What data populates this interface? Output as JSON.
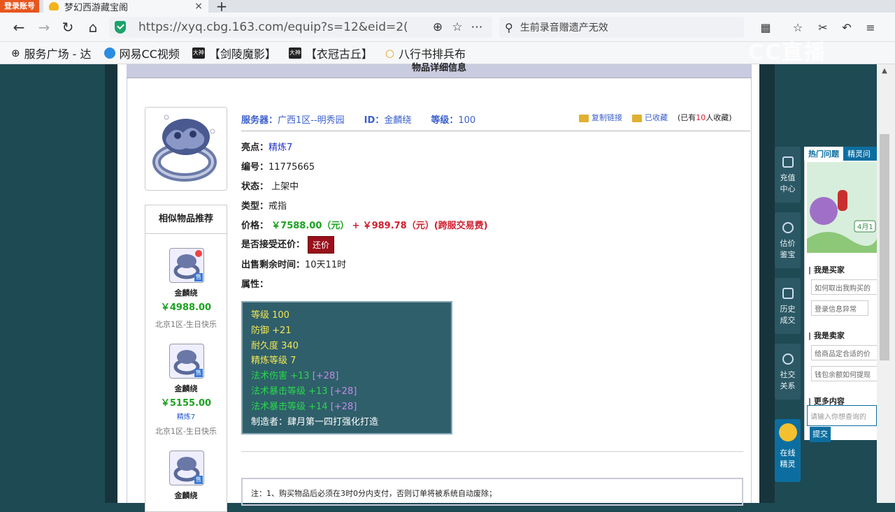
{
  "browser": {
    "record_badge": "登录账号",
    "tab_title": "梦幻西游藏宝阁",
    "tab_close": "×",
    "new_tab": "+",
    "url": "https://xyq.cbg.163.com/equip?s=12&eid=2(",
    "search_placeholder": "生前录音赠遗产无效",
    "bookmarks": [
      {
        "label": "服务广场 - 达",
        "icon": "grid-icon"
      },
      {
        "label": "网易CC视频",
        "icon": "cc-icon"
      },
      {
        "label": "【剑陵魔影】",
        "icon": "dashen-icon",
        "badge": "大神"
      },
      {
        "label": "【衣冠古丘】",
        "icon": "dashen-icon",
        "badge": "大神"
      },
      {
        "label": "八行书排兵布",
        "icon": "search-icon"
      }
    ],
    "watermark": "CC直播"
  },
  "page": {
    "section_title": "物品详细信息",
    "info_top": {
      "server_label": "服务器：",
      "server_value": "广西1区--明秀园",
      "id_label": "ID：",
      "id_value": "金麟绕",
      "level_label": "等级：",
      "level_value": "100"
    },
    "fav_links": {
      "copy_link": "复制链接",
      "favorited": "已收藏",
      "fav_count_prefix": "(已有",
      "fav_count": "10",
      "fav_count_suffix": "人收藏)"
    },
    "highlight_label": "亮点：",
    "highlight_value": "精炼7",
    "serial_label": "编号：",
    "serial_value": "11775665",
    "status_label": "状态：",
    "status_value": "上架中",
    "type_label": "类型：",
    "type_value": "戒指",
    "price_label": "价格：",
    "price_value": "￥7588.00（元）",
    "price_plus": "+",
    "cross_fee": "￥989.78（元）(跨服交易费)",
    "counter_label": "是否接受还价：",
    "counter_button": "还价",
    "remaining_label": "出售剩余时间：",
    "remaining_value": "10天11时",
    "attr_label": "属性：",
    "attributes": [
      {
        "text": "等级 100",
        "color": "#f5e650"
      },
      {
        "text": "防御 +21",
        "color": "#f5e650"
      },
      {
        "text": "耐久度 340",
        "color": "#f5e650"
      },
      {
        "text": "精炼等级 7",
        "color": "#f5e650"
      }
    ],
    "magic_attrs": [
      {
        "text": "法术伤害 +13",
        "bonus": "[+28]"
      },
      {
        "text": "法术暴击等级 +13",
        "bonus": "[+28]"
      },
      {
        "text": "法术暴击等级 +14",
        "bonus": "[+28]"
      }
    ],
    "maker": "制造者：肆月第一四打强化打造",
    "notice": "注：1、购买物品后必须在3时0分内支付，否则订单将被系统自动废除；"
  },
  "similar": {
    "title": "相似物品推荐",
    "items": [
      {
        "name": "金麟绕",
        "price": "￥4988.00",
        "extra": "",
        "server": "北京1区-生日快乐"
      },
      {
        "name": "金麟绕",
        "price": "￥5155.00",
        "extra": "精炼7",
        "server": "北京1区-生日快乐"
      },
      {
        "name": "金麟绕",
        "price": "",
        "extra": "",
        "server": ""
      }
    ],
    "sold_badge": "售"
  },
  "sidebar": {
    "buttons": [
      {
        "label1": "充值",
        "label2": "中心"
      },
      {
        "label1": "估价",
        "label2": "鉴宝"
      },
      {
        "label1": "历史",
        "label2": "成交"
      },
      {
        "label1": "社交",
        "label2": "关系"
      }
    ],
    "jingling1": "在线",
    "jingling2": "精灵"
  },
  "help": {
    "tab_hot": "热门问题",
    "tab_other": "精灵问",
    "banner_text": "4月1",
    "buyer_head": "| 我是买家",
    "buyer_items": [
      "如何取出我购买的",
      "登录信息异常"
    ],
    "seller_head": "| 我是卖家",
    "seller_items": [
      "给商品定合适的价",
      "钱包余额如何提现"
    ],
    "more_head": "| 更多内容",
    "input_placeholder": "请输入你想查询的",
    "submit": "提交"
  }
}
